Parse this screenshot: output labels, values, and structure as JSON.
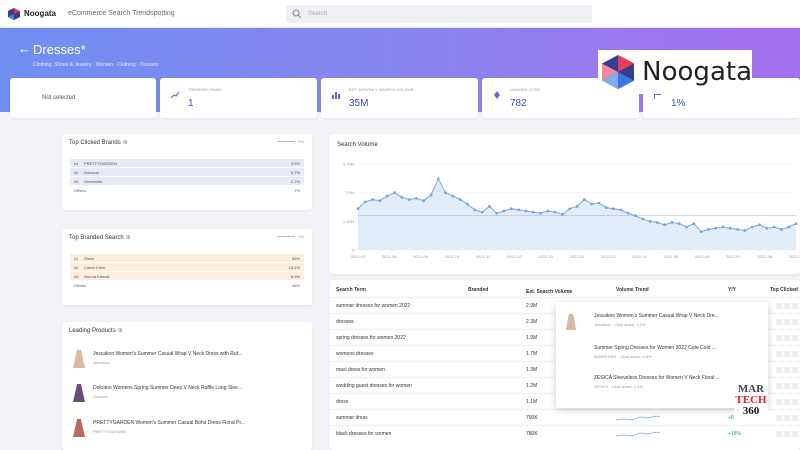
{
  "topbar": {
    "brand": "Noogata",
    "app_title": "eCommerce Search Trendspotting",
    "search_placeholder": "Search"
  },
  "hero": {
    "title": "Dresses",
    "title_mark": "*",
    "breadcrumb": "Clothing, Shoes & Jewelry · Women · Clothing · Dresses"
  },
  "stats": {
    "selected_label": "Not selected",
    "metrics": [
      {
        "label": "TRENDING RANK",
        "value": "1",
        "icon": "trend-up-icon"
      },
      {
        "label": "EST. MONTHLY SEARCH VOLUME",
        "value": "35M",
        "icon": "bar-chart-icon"
      },
      {
        "label": "LEADING CONV.",
        "value": "782",
        "icon": "rocket-icon"
      },
      {
        "label": "BRANDED SEARCH SH.",
        "value": "1%",
        "icon": "flag-icon"
      }
    ]
  },
  "logos": {
    "noogata_word": "Noogata",
    "martech_lines": [
      "MAR",
      "TECH",
      "360"
    ]
  },
  "top_clicked_brands": {
    "title": "Top Clicked Brands",
    "control_value": "0%",
    "rows": [
      {
        "rank": "#1",
        "name": "PRETTYGARDEN",
        "share": "3.9%"
      },
      {
        "rank": "#2",
        "name": "Dokotoo",
        "share": "0.7%"
      },
      {
        "rank": "#3",
        "name": "Grecerelle",
        "share": "0.7%"
      }
    ],
    "others_label": "Others",
    "others_value": "7%"
  },
  "top_branded_search": {
    "title": "Top Branded Search",
    "control_value": "1%",
    "rows": [
      {
        "rank": "#1",
        "name": "Shein",
        "share": "86%"
      },
      {
        "rank": "#2",
        "name": "Calvin Klein",
        "share": "18.1%"
      },
      {
        "rank": "#3",
        "name": "Norma Kamali",
        "share": "8.9%"
      }
    ],
    "others_label": "Others",
    "others_value": "46%"
  },
  "leading_products": {
    "title": "Leading Products",
    "items": [
      {
        "name": "Jescakoo Women's Summer Casual Wrap V Neck Dress with Ruf...",
        "brand": "Jescakoo"
      },
      {
        "name": "Dokotoo Womens Spring Summer Deep V Neck Ruffle Long Slee...",
        "brand": "Dokotoo"
      },
      {
        "name": "PRETTYGARDEN Women's Summer Casual Boho Dress Floral Pr...",
        "brand": "PRETTYGARDEN"
      }
    ]
  },
  "chart_data": {
    "type": "line",
    "title": "Search Volume",
    "x": [
      "2021-07",
      "2021-08",
      "2021-09",
      "2021-10",
      "2021-11",
      "2021-12",
      "2022-01",
      "2022-02",
      "2022-03",
      "2022-04",
      "2022-05",
      "2022-06",
      "2022-07",
      "2022-08",
      "2022-09"
    ],
    "tick_labels": [
      "2021-07",
      "2021-08",
      "2021-09",
      "2021-10",
      "2021-11",
      "2021-12",
      "2022-01",
      "2022-02",
      "2022-03",
      "2022-04",
      "2022-05",
      "2022-06",
      "2022-07",
      "2022-08",
      "2022-09"
    ],
    "y_ticks": [
      "0",
      "1.25M",
      "2.5M",
      "3.75M"
    ],
    "ylim": [
      0,
      3.75
    ],
    "series": [
      {
        "values": [
          1.8,
          2.1,
          2.2,
          2.15,
          2.35,
          2.5,
          2.3,
          2.2,
          2.25,
          2.15,
          2.4,
          3.1,
          2.5,
          2.35,
          2.2,
          2.0,
          1.75,
          1.65,
          1.9,
          1.6,
          1.7,
          1.8,
          1.75,
          1.7,
          1.65,
          1.6,
          1.7,
          1.65,
          1.55,
          1.8,
          1.9,
          2.2,
          2.0,
          2.05,
          1.85,
          1.8,
          1.75,
          1.6,
          1.5,
          1.35,
          1.25,
          1.2,
          1.1,
          1.2,
          1.15,
          1.0,
          1.15,
          0.8,
          0.9,
          0.95,
          1.0,
          0.95,
          0.9,
          0.85,
          1.0,
          1.1,
          0.95,
          1.0,
          0.9,
          1.0,
          1.15
        ]
      }
    ],
    "reference_line": 1.5,
    "grid": true,
    "line_color": "#7aa6dc",
    "fill_color": "#dbe8f8"
  },
  "table": {
    "headers": [
      "Search Term",
      "Branded",
      "Est. Search Volume",
      "Volume Trend",
      "Y/Y",
      "Top Clicked"
    ],
    "sort_indicator": "↓",
    "rows": [
      {
        "term": "summer dresses for women 2022",
        "vol": "2.9M",
        "yy": "+135%"
      },
      {
        "term": "dresses",
        "vol": "2.3M",
        "yy": "+6%"
      },
      {
        "term": "spring dresses for women 2022",
        "vol": "1.9M",
        "yy": "+28%"
      },
      {
        "term": "womens dresses",
        "vol": "1.7M",
        "yy": "+12%"
      },
      {
        "term": "maxi dress for women",
        "vol": "1.3M",
        "yy": "+48%"
      },
      {
        "term": "wedding guest dresses for women",
        "vol": "1.2M",
        "yy": "+59%"
      },
      {
        "term": "dress",
        "vol": "1.1M",
        "yy": "+8%"
      },
      {
        "term": "summer dress",
        "vol": "790K",
        "yy": "+84%"
      },
      {
        "term": "black dresses for women",
        "vol": "780K",
        "yy": "+18%"
      }
    ]
  },
  "popup": {
    "items": [
      {
        "title": "Jescakoo Women's Summer Casual Wrap V Neck Dre...",
        "sub": "Jescakoo · Click share: 4.1%"
      },
      {
        "title": "Summer Spring Dresses for Women 2022 Cute Cold ...",
        "sub": "BANREGIRL · Click share: 2.8%"
      },
      {
        "title": "ZESICA Sleeveless Dresses for Women V Neck Floral ...",
        "sub": "ZESICA · Click share: 2.2%"
      }
    ]
  }
}
